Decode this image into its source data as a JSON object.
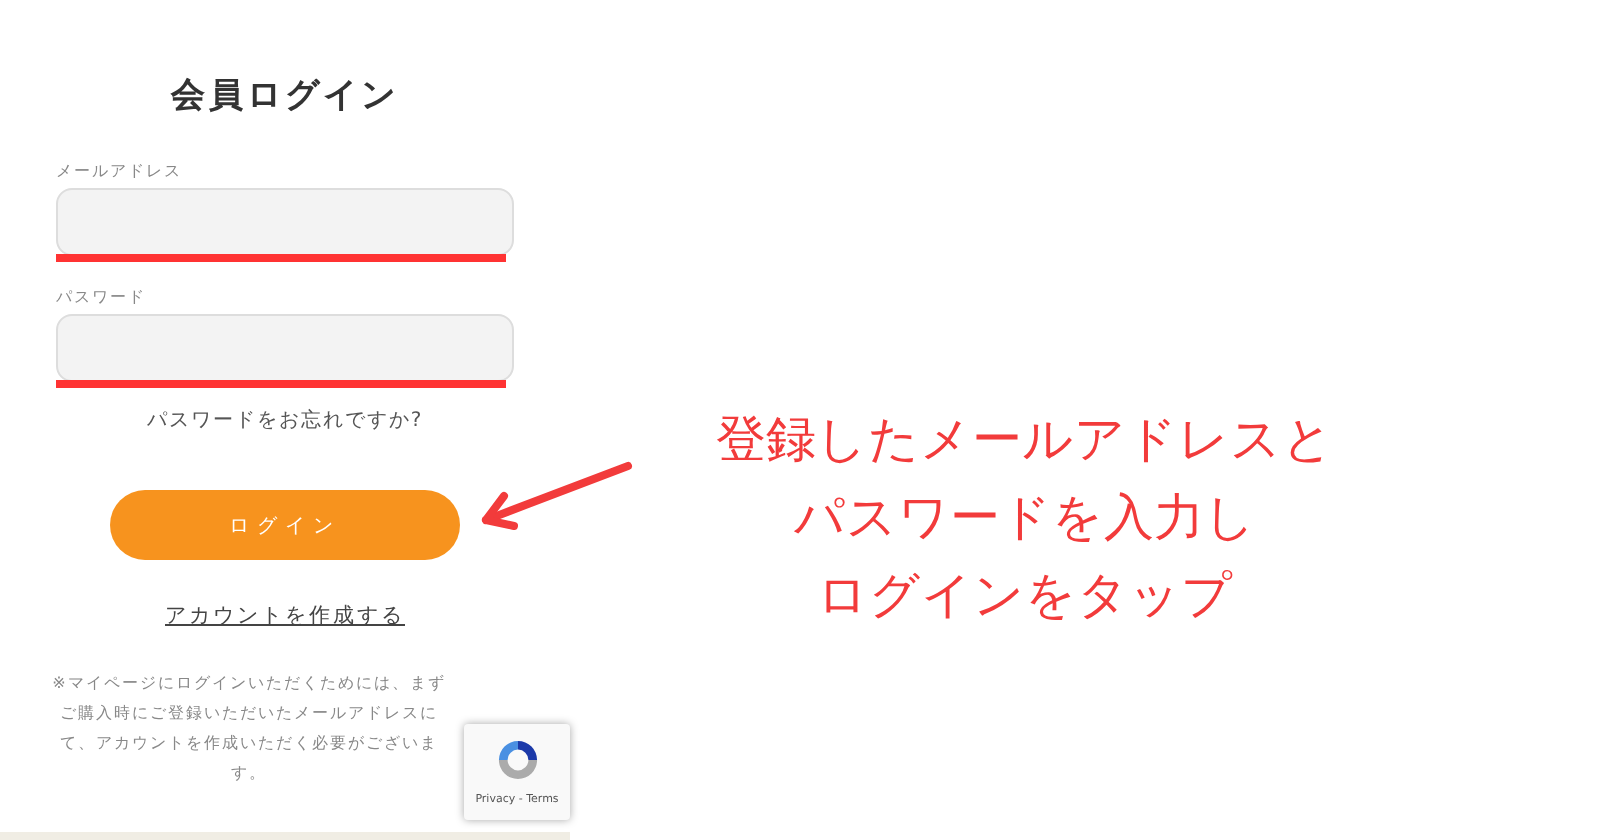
{
  "page": {
    "title": "会員ログイン",
    "fields": [
      {
        "label": "メールアドレス",
        "highlighted": true
      },
      {
        "label": "パスワード",
        "highlighted": true
      }
    ],
    "forgot_link": "パスワードをお忘れですか?",
    "login_button": "ログイン",
    "create_account_link": "アカウントを作成する",
    "note": "※マイページにログインいただくためには、まずご購入時にご登録いただいたメールアドレスにて、アカウントを作成いただく必要がございます。"
  },
  "recaptcha": {
    "text": "Privacy - Terms"
  },
  "annotation": {
    "lines": [
      "登録したメールアドレスと",
      "パスワードを入力し",
      "ログインをタップ"
    ]
  }
}
